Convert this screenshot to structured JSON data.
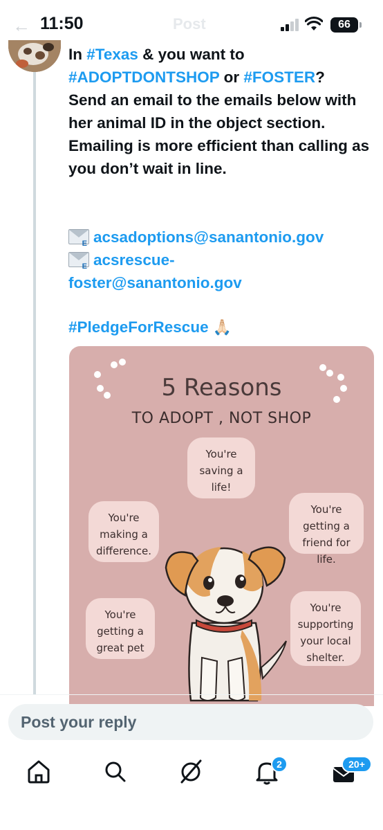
{
  "status_bar": {
    "time": "11:50",
    "header_title": "Post",
    "battery": "66"
  },
  "tweet": {
    "text_segments": [
      {
        "text": "In ",
        "tag": false
      },
      {
        "text": "#Texas",
        "tag": true
      },
      {
        "text": " & you want to\n",
        "tag": false
      },
      {
        "text": "#ADOPTDONTSHOP",
        "tag": true
      },
      {
        "text": " or ",
        "tag": false
      },
      {
        "text": "#FOSTER",
        "tag": true
      },
      {
        "text": "?\nSend an email to the emails below with her animal ID in the object section. Emailing is more efficient than calling as you don’t wait in line.",
        "tag": false
      }
    ],
    "email_1": "acsadoptions@sanantonio.gov",
    "email_2_line1": "acsrescue-",
    "email_2_line2": "foster@sanantonio.gov",
    "email_icon_name": "envelope-icon",
    "pledge_tag": "#PledgeForRescue",
    "pledge_emoji": "🙏🏻"
  },
  "media": {
    "title": "5 Reasons",
    "subtitle": "TO ADOPT , NOT SHOP",
    "reasons": [
      "You're\nsaving a\nlife!",
      "You're\nmaking a\ndifference.",
      "You're\ngetting a\nfriend for life.",
      "You're\ngetting a\ngreat pet",
      "You're\nsupporting\nyour local\nshelter."
    ],
    "background_color": "#d7aeac",
    "bubble_color": "#f3d9d6"
  },
  "reply": {
    "placeholder": "Post your reply"
  },
  "nav": {
    "items": [
      "home-icon",
      "search-icon",
      "grok-icon",
      "notifications-icon",
      "messages-icon"
    ],
    "notifications_badge": "2",
    "messages_badge": "20+"
  },
  "colors": {
    "accent": "#1d9bf0",
    "text": "#0f1419",
    "muted": "#536471"
  }
}
